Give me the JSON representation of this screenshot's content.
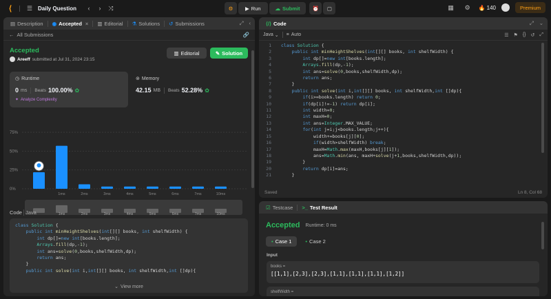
{
  "topbar": {
    "title": "Daily Question",
    "run": "Run",
    "submit": "Submit",
    "streak": "140",
    "premium": "Premium"
  },
  "left": {
    "tabs": [
      "Description",
      "Accepted",
      "Editorial",
      "Solutions",
      "Submissions"
    ],
    "back": "All Submissions",
    "status": "Accepted",
    "user": "Areeff",
    "submitted": "submitted at Jul 31, 2024 23:15",
    "editorial_btn": "Editorial",
    "solution_btn": "Solution",
    "runtime": {
      "label": "Runtime",
      "value": "0",
      "unit": "ms",
      "beats_label": "Beats",
      "beats": "100.00%",
      "analyze": "Analyze Complexity"
    },
    "memory": {
      "label": "Memory",
      "value": "42.15",
      "unit": "MB",
      "beats_label": "Beats",
      "beats": "52.28%"
    },
    "code_label": "Code",
    "lang": "Java",
    "view_more": "View more"
  },
  "chart_data": {
    "type": "bar",
    "y_ticks": [
      "75%",
      "50%",
      "25%",
      "0%"
    ],
    "ylim": [
      0,
      75
    ],
    "values": [
      22,
      57,
      6,
      3,
      3,
      3,
      3,
      3,
      3
    ],
    "x_labels": [
      "",
      "1ms",
      "2ms",
      "3ms",
      "4ms",
      "5ms",
      "6ms",
      "7ms",
      "10ms"
    ],
    "mini_labels": [
      "",
      "1ms",
      "2ms",
      "3ms",
      "4ms",
      "5ms",
      "6ms",
      "7ms",
      "10ms"
    ],
    "highlight_index": 0,
    "bar_color": "#1a90ff"
  },
  "editor": {
    "title": "Code",
    "lang": "Java",
    "mode": "Auto",
    "status": "Saved",
    "cursor": "Ln 8, Col 68"
  },
  "bottom": {
    "tabs": [
      "Testcase",
      "Test Result"
    ],
    "status": "Accepted",
    "runtime": "Runtime: 0 ms",
    "cases": [
      "Case 1",
      "Case 2"
    ],
    "input_label": "Input",
    "var1": "books =",
    "val1": "[[1,1],[2,3],[2,3],[1,1],[1,1],[1,1],[1,2]]",
    "var2": "shelfWidth ="
  },
  "colors": {
    "accent_green": "#2cbb5d",
    "accent_orange": "#ffa116",
    "blue": "#1a90ff"
  }
}
